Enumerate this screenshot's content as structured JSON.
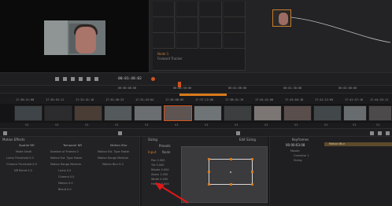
{
  "viewer": {
    "timecode": "00:01:48:02"
  },
  "node_graph": {
    "node_label": "Node 1",
    "node_sub": "Forward Tracker"
  },
  "ruler_marks": [
    "00:00:00:00",
    "00:00:30:00",
    "00:01:00:00",
    "00:01:30:00",
    "00:02:00:00"
  ],
  "clip_timecodes": [
    "17:36:21:08",
    "17:35:55:11",
    "17:32:41:18",
    "17:32:48:23",
    "17:31:43:04",
    "17:36:08:05",
    "17:37:12:06",
    "17:38:41:19",
    "17:44:41:00",
    "17:43:04:18",
    "17:41:12:05",
    "17:41:57:16",
    "17:44:43:11"
  ],
  "clip_tracks": [
    "V1",
    "V1",
    "V1",
    "V1",
    "V1",
    "V1",
    "V1",
    "V1",
    "V1",
    "V1",
    "V1",
    "V1",
    "V1"
  ],
  "motion_effects": {
    "title": "Motion Effects",
    "spatial": {
      "title": "Spatial NR",
      "rows": [
        "Mode  Small",
        "Luma Threshold  0.0",
        "Chroma Threshold  0.0",
        "NR Blend  0.0"
      ]
    },
    "temporal": {
      "title": "Temporal NR",
      "rows": [
        "Number of Frames  0",
        "Motion Est. Type  Faster",
        "Motion Range  Medium",
        "Luma  0.0",
        "Chroma  0.0",
        "Motion  0.0",
        "Blend  0.0"
      ]
    },
    "blur": {
      "title": "Motion Blur",
      "rows": [
        "Motion Est. Type  Faster",
        "Motion Range  Medium",
        "Motion Blur  0.0"
      ]
    }
  },
  "sizing": {
    "title": "Sizing",
    "preset": "Presets",
    "tab_input": "Input",
    "tab_node": "Node",
    "labels": [
      "Pan  0.000",
      "Tilt  0.000",
      "Rotate  0.000",
      "Zoom  1.000",
      "Width  0.000",
      "Height  0.000"
    ],
    "right_label": "Edit Sizing"
  },
  "keyframes": {
    "title": "Keyframes",
    "timecode": "00:00:03:08",
    "rows": [
      "Master",
      "Corrector 1",
      "Sizing"
    ],
    "bar_label": "Motion Blur"
  }
}
